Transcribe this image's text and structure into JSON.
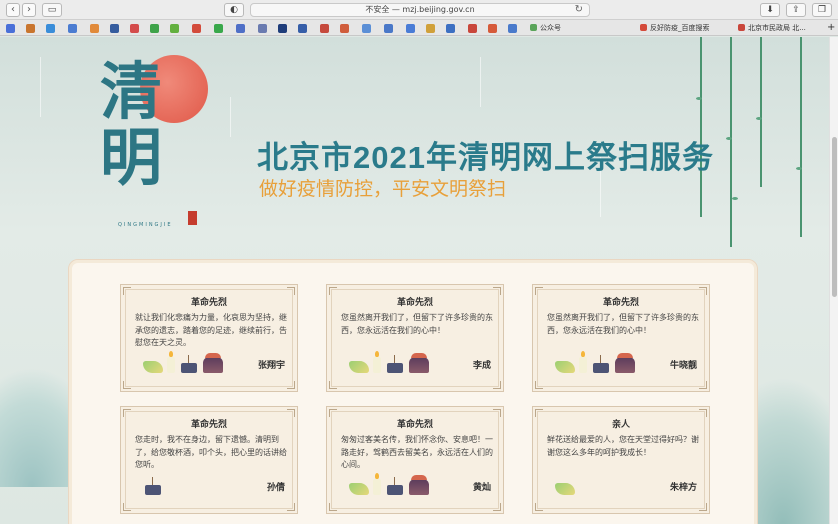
{
  "browser": {
    "url": "不安全 — mzj.beijing.gov.cn",
    "tabs": [
      {
        "label": "公众号"
      },
      {
        "label": "反好防疫_百度搜索"
      },
      {
        "label": "北京市民政局 北..."
      }
    ]
  },
  "page": {
    "logo_text": "清明",
    "logo_sub": "QINGMINGJIE",
    "title": "北京市2021年清明网上祭扫服务",
    "subtitle": "做好疫情防控，平安文明祭扫"
  },
  "cards": [
    {
      "title": "革命先烈",
      "message": "就让我们化悲痛为力量，化哀思为坚持，继承您的遗志，踏着您的足迹，继续前行，告慰您在天之灵。",
      "name": "张翔宇",
      "offerings": [
        "flower",
        "candle",
        "incense",
        "food"
      ]
    },
    {
      "title": "革命先烈",
      "message": "您虽然离开我们了，但留下了许多珍贵的东西，您永远活在我们的心中！",
      "name": "李成",
      "offerings": [
        "flower",
        "candle",
        "incense",
        "food"
      ]
    },
    {
      "title": "革命先烈",
      "message": "您虽然离开我们了，但留下了许多珍贵的东西，您永远活在我们的心中！",
      "name": "牛晓靓",
      "offerings": [
        "flower",
        "candle",
        "incense",
        "food"
      ]
    },
    {
      "title": "革命先烈",
      "message": "您走时，我不在身边，留下遗憾。清明到了，给您敬杯酒，叩个头，把心里的话讲给您听。",
      "name": "孙倩",
      "offerings": [
        "incense"
      ]
    },
    {
      "title": "革命先烈",
      "message": "匆匆过客美名传，我们怀念你、安息吧！一路走好，驾鹤西去留美名，永远活在人们的心间。",
      "name": "黄灿",
      "offerings": [
        "flower",
        "candle",
        "incense",
        "food"
      ]
    },
    {
      "title": "亲人",
      "message": "鲜花送给最爱的人，您在天堂过得好吗？谢谢您这么多年的呵护我成长！",
      "name": "朱梓方",
      "offerings": [
        "flower"
      ]
    }
  ]
}
